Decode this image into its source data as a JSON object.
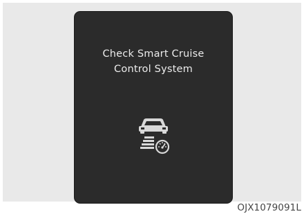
{
  "display": {
    "message_line1": "Check Smart Cruise",
    "message_line2": "Control System",
    "icon": "smart-cruise-control-warning-icon"
  },
  "figure": {
    "code": "OJX1079091L"
  },
  "colors": {
    "display_background": "#2b2b2b",
    "frame_background": "#e9e9e9",
    "text": "#ececec"
  }
}
